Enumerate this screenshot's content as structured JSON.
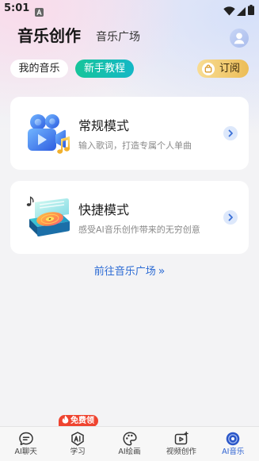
{
  "status_bar": {
    "time": "5:01",
    "icons": [
      "notification-a-icon",
      "wifi-icon",
      "signal-icon",
      "battery-icon"
    ]
  },
  "header": {
    "title": "音乐创作",
    "plaza_tab": "音乐广场",
    "avatar_icon": "user-avatar-icon"
  },
  "tabs": [
    {
      "label": "我的音乐",
      "active": false
    },
    {
      "label": "新手教程",
      "active": true
    }
  ],
  "subscribe": {
    "label": "订阅",
    "icon": "shopping-bag-icon"
  },
  "modes": [
    {
      "title": "常规模式",
      "description": "输入歌词，打造专属个人单曲",
      "icon": "film-camera-music-icon"
    },
    {
      "title": "快捷模式",
      "description": "感受AI音乐创作带来的无穷创意",
      "icon": "record-player-icon"
    }
  ],
  "plaza_link": {
    "label": "前往音乐广场",
    "arrow": "»"
  },
  "bottom_nav": {
    "items": [
      {
        "label": "AI聊天",
        "icon": "chat-bubble-icon",
        "active": false
      },
      {
        "label": "学习",
        "icon": "ai-learning-icon",
        "active": false,
        "badge": "免费领",
        "badge_icon": "fire-icon"
      },
      {
        "label": "AI绘画",
        "icon": "palette-icon",
        "active": false
      },
      {
        "label": "视频创作",
        "icon": "video-create-icon",
        "active": false
      },
      {
        "label": "AI音乐",
        "icon": "music-disc-icon",
        "active": true
      }
    ]
  },
  "colors": {
    "accent_blue": "#2a5fd1",
    "link_blue": "#2c6bd4",
    "tutorial_gradient": [
      "#17c59a",
      "#14b7c6"
    ],
    "subscribe_gradient": [
      "#f8dc93",
      "#ecbd57"
    ],
    "badge_red": "#ef4430",
    "page_background": "#f3f3f5",
    "card_background": "#ffffff"
  }
}
